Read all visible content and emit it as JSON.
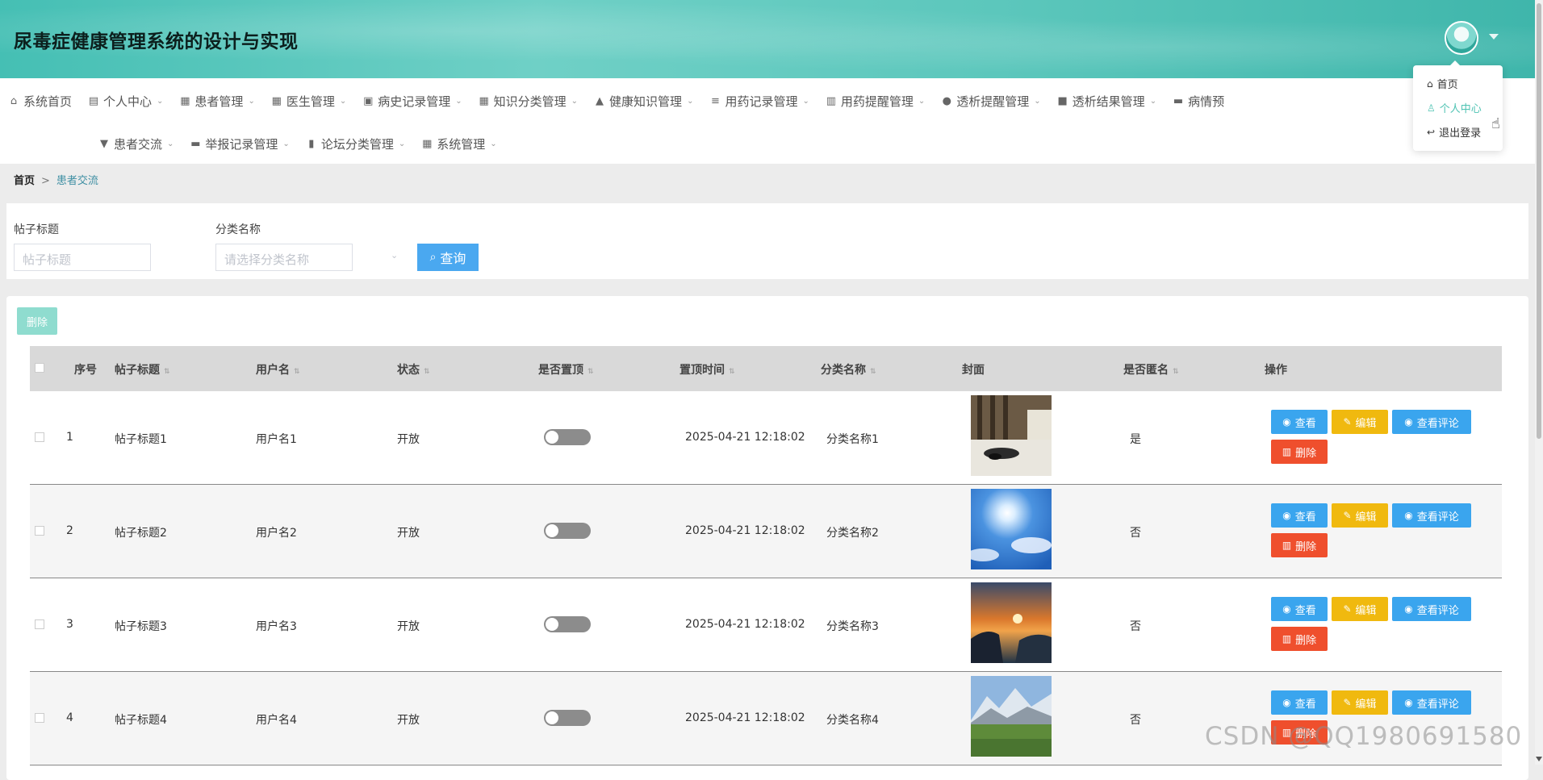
{
  "app": {
    "title": "尿毒症健康管理系统的设计与实现"
  },
  "nav": {
    "row1": [
      {
        "icon": "home-icon",
        "glyph": "⌂",
        "label": "系统首页",
        "caret": false
      },
      {
        "icon": "card-icon",
        "glyph": "▤",
        "label": "个人中心",
        "caret": true
      },
      {
        "icon": "grid-icon",
        "glyph": "▦",
        "label": "患者管理",
        "caret": true
      },
      {
        "icon": "grid-icon",
        "glyph": "▦",
        "label": "医生管理",
        "caret": true
      },
      {
        "icon": "doc-icon",
        "glyph": "▣",
        "label": "病史记录管理",
        "caret": true
      },
      {
        "icon": "grid-icon",
        "glyph": "▦",
        "label": "知识分类管理",
        "caret": true
      },
      {
        "icon": "user-icon",
        "glyph": "▲",
        "label": "健康知识管理",
        "caret": true
      },
      {
        "icon": "list-icon",
        "glyph": "≡",
        "label": "用药记录管理",
        "caret": true
      },
      {
        "icon": "bar-chart-icon",
        "glyph": "▥",
        "label": "用药提醒管理",
        "caret": true
      },
      {
        "icon": "bulb-icon",
        "glyph": "●",
        "label": "透析提醒管理",
        "caret": true
      },
      {
        "icon": "camera-icon",
        "glyph": "■",
        "label": "透析结果管理",
        "caret": true
      },
      {
        "icon": "print-icon",
        "glyph": "▬",
        "label": "病情预",
        "caret": false
      }
    ],
    "row2": [
      {
        "icon": "stamp-icon",
        "glyph": "▼",
        "label": "患者交流",
        "caret": true
      },
      {
        "icon": "briefcase-icon",
        "glyph": "▬",
        "label": "举报记录管理",
        "caret": true
      },
      {
        "icon": "book-icon",
        "glyph": "▮",
        "label": "论坛分类管理",
        "caret": true
      },
      {
        "icon": "grid-icon",
        "glyph": "▦",
        "label": "系统管理",
        "caret": true
      }
    ]
  },
  "breadcrumb": {
    "home": "首页",
    "separator": ">",
    "current": "患者交流"
  },
  "search": {
    "title_label": "帖子标题",
    "title_placeholder": "帖子标题",
    "category_label": "分类名称",
    "category_placeholder": "请选择分类名称",
    "query_button": "查询"
  },
  "toolbar": {
    "delete_label": "删除"
  },
  "table": {
    "headers": {
      "index": "序号",
      "title": "帖子标题",
      "username": "用户名",
      "status": "状态",
      "pinned": "是否置顶",
      "pin_time": "置顶时间",
      "category": "分类名称",
      "cover": "封面",
      "anonymous": "是否匿名",
      "actions": "操作"
    },
    "actions": {
      "view": "查看",
      "edit": "编辑",
      "comments": "查看评论",
      "delete": "删除"
    },
    "rows": [
      {
        "index": "1",
        "title": "帖子标题1",
        "username": "用户名1",
        "status": "开放",
        "pin_time": "2025-04-21 12:18:02",
        "category": "分类名称1",
        "anonymous": "是",
        "pinned": false,
        "cover": "bedroom"
      },
      {
        "index": "2",
        "title": "帖子标题2",
        "username": "用户名2",
        "status": "开放",
        "pin_time": "2025-04-21 12:18:02",
        "category": "分类名称2",
        "anonymous": "否",
        "pinned": false,
        "cover": "sky"
      },
      {
        "index": "3",
        "title": "帖子标题3",
        "username": "用户名3",
        "status": "开放",
        "pin_time": "2025-04-21 12:18:02",
        "category": "分类名称3",
        "anonymous": "否",
        "pinned": false,
        "cover": "sunset"
      },
      {
        "index": "4",
        "title": "帖子标题4",
        "username": "用户名4",
        "status": "开放",
        "pin_time": "2025-04-21 12:18:02",
        "category": "分类名称4",
        "anonymous": "否",
        "pinned": false,
        "cover": "mountain"
      }
    ]
  },
  "user_menu": {
    "items": [
      "首页",
      "个人中心",
      "退出登录"
    ],
    "active_index": 1
  },
  "watermark": "CSDN @QQ1980691580",
  "colors": {
    "primary": "#3aa5ee",
    "warning": "#f0b90f",
    "danger": "#ef4f2d",
    "accent": "#4fc3b3"
  }
}
